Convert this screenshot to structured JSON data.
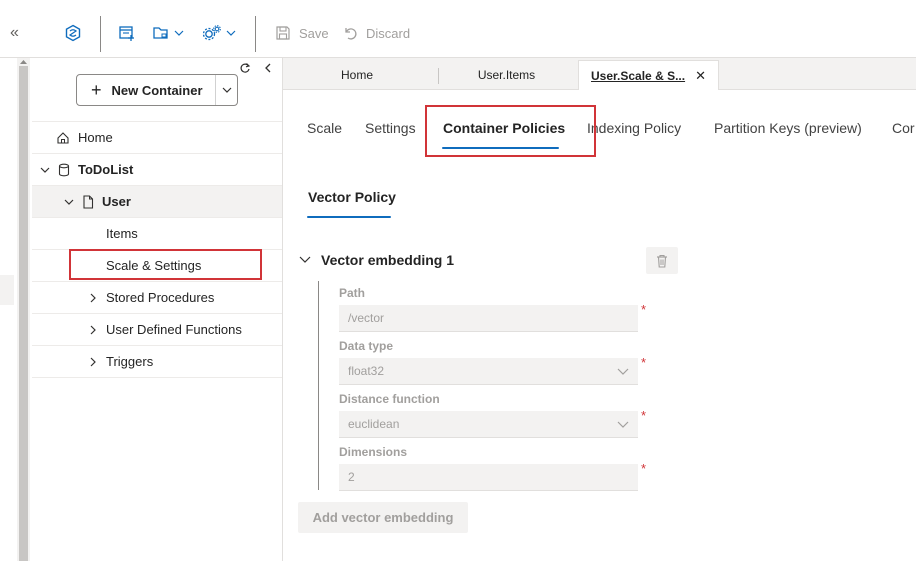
{
  "toolbar": {
    "save_label": "Save",
    "discard_label": "Discard",
    "icons": [
      "collapse-left-icon",
      "cosmos-icon",
      "new-container-icon",
      "open-folder-icon",
      "settings-gear-icon"
    ]
  },
  "sidebar": {
    "new_container_label": "New Container",
    "items": [
      {
        "label": "Home"
      },
      {
        "label": "ToDoList"
      },
      {
        "label": "User"
      },
      {
        "label": "Items"
      },
      {
        "label": "Scale & Settings"
      },
      {
        "label": "Stored Procedures"
      },
      {
        "label": "User Defined Functions"
      },
      {
        "label": "Triggers"
      }
    ]
  },
  "tabs": [
    {
      "label": "Home"
    },
    {
      "label": "User.Items"
    },
    {
      "label": "User.Scale & S..."
    }
  ],
  "subtabs": [
    {
      "label": "Scale"
    },
    {
      "label": "Settings"
    },
    {
      "label": "Container Policies"
    },
    {
      "label": "Indexing Policy"
    },
    {
      "label": "Partition Keys (preview)"
    },
    {
      "label": "Cor"
    }
  ],
  "policy": {
    "section_tab": "Vector Policy",
    "embedding_title": "Vector embedding 1",
    "fields": [
      {
        "label": "Path",
        "value": "/vector"
      },
      {
        "label": "Data type",
        "value": "float32"
      },
      {
        "label": "Distance function",
        "value": "euclidean"
      },
      {
        "label": "Dimensions",
        "value": "2"
      }
    ],
    "required_mark": "*",
    "add_button_label": "Add vector embedding"
  },
  "colors": {
    "accent": "#0f6cbd",
    "highlight": "#d13438",
    "disabled_text": "#a19f9d"
  }
}
